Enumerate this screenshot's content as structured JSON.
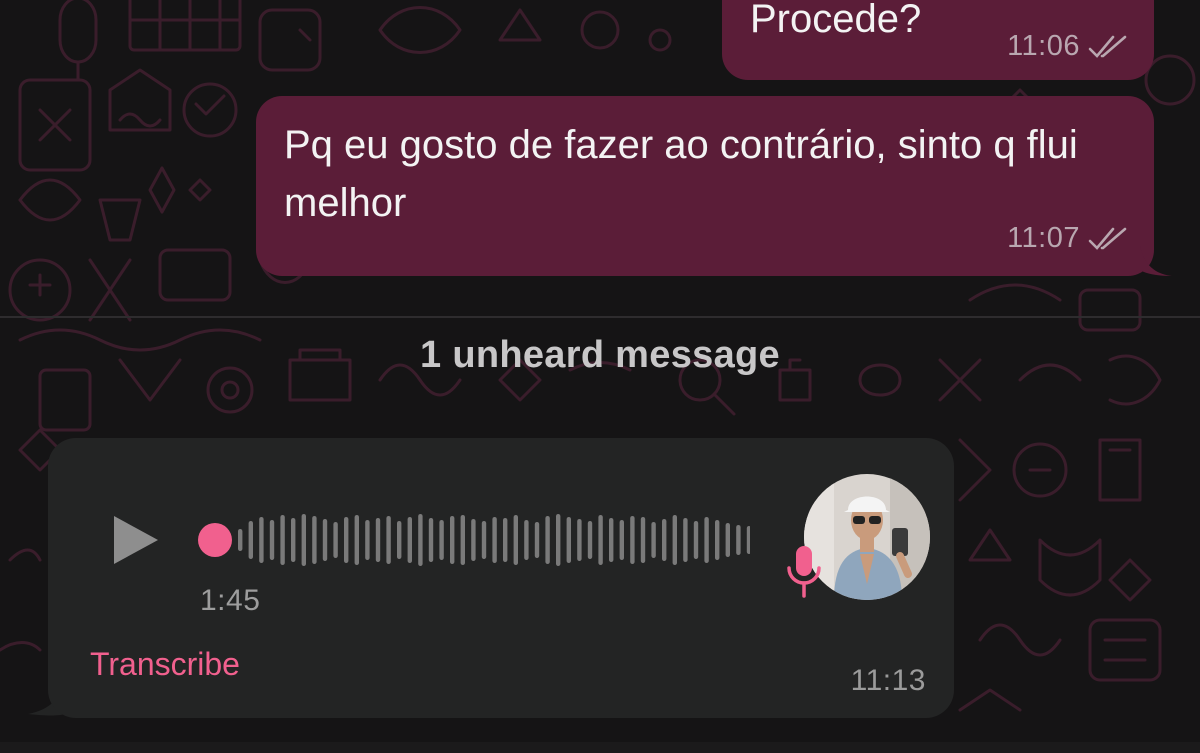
{
  "messages": [
    {
      "id": "msg-1",
      "direction": "outgoing",
      "text": "Procede?",
      "time": "11:06",
      "status": "read"
    },
    {
      "id": "msg-2",
      "direction": "outgoing",
      "text": "Pq eu gosto de fazer ao contrário, sinto q flui melhor",
      "time": "11:07",
      "status": "read"
    }
  ],
  "divider_label": "1 unheard message",
  "voice_message": {
    "direction": "incoming",
    "duration": "1:45",
    "time": "11:13",
    "transcribe_label": "Transcribe",
    "progress": 0,
    "play_icon": "play-icon",
    "mic_icon": "microphone-icon"
  },
  "colors": {
    "outgoing_bubble": "#5b1d38",
    "incoming_bubble": "#232424",
    "accent": "#f1608e",
    "background": "#151415"
  }
}
